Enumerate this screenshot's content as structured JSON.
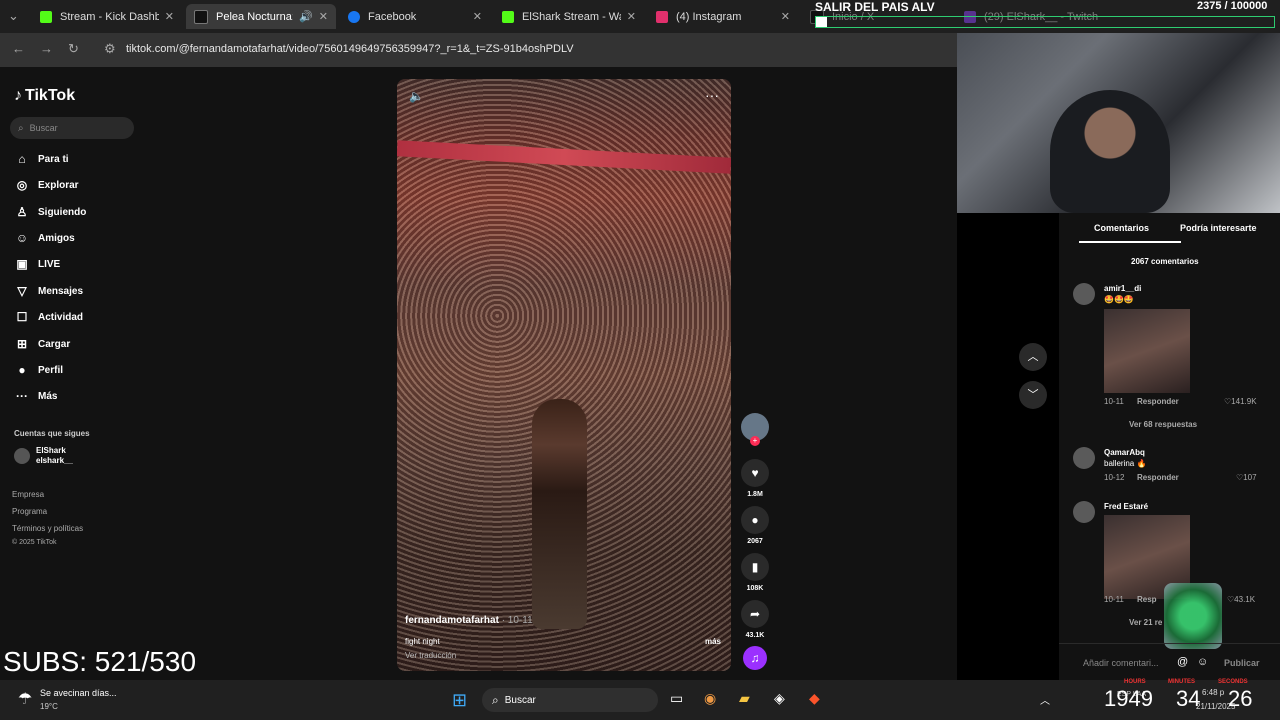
{
  "tabs": [
    {
      "label": "Stream - Kick Dashboa",
      "color": "#53fc18"
    },
    {
      "label": "Pelea Nocturna: Fe",
      "color": "#111111"
    },
    {
      "label": "Facebook",
      "color": "#1877f2"
    },
    {
      "label": "ElShark Stream - Watc",
      "color": "#53fc18"
    },
    {
      "label": "(4) Instagram",
      "color": "#e1306c"
    },
    {
      "label": "Inicio / X",
      "color": "#000000"
    },
    {
      "label": "(29) ElShark__ - Twitch",
      "color": "#9146ff"
    }
  ],
  "url": "tiktok.com/@fernandamotafarhat/video/7560149649756359947?_r=1&_t=ZS-91b4oshPDLV",
  "overlay": {
    "salir": "SALIR DEL PAIS ALV",
    "goal": "2375 / 100000",
    "subs": "SUBS: 521/530",
    "timer_labels": [
      "HOURS",
      "MINUTES",
      "SECONDS"
    ],
    "timer_values": [
      "1949",
      "34",
      "26"
    ]
  },
  "tiktok": {
    "logo": "TikTok",
    "search_placeholder": "Buscar",
    "nav": [
      "Para ti",
      "Explorar",
      "Siguiendo",
      "Amigos",
      "LIVE",
      "Mensajes",
      "Actividad",
      "Cargar",
      "Perfil",
      "Más"
    ],
    "following_title": "Cuentas que sigues",
    "following": {
      "name": "ElShark",
      "handle": "elshark__"
    },
    "footer": [
      "Empresa",
      "Programa",
      "Términos y políticas",
      "© 2025 TikTok"
    ],
    "video": {
      "author": "fernandamotafarhat",
      "date": "· 10-11",
      "caption": "fight night",
      "translate": "Ver traducción",
      "more": "más"
    },
    "actions": {
      "likes": "1.8M",
      "comments": "2067",
      "saves": "108K",
      "shares": "43.1K"
    }
  },
  "comments": {
    "tabs": [
      "Comentarios",
      "Podría interesarte"
    ],
    "count": "2067 comentarios",
    "items": [
      {
        "user": "amir1__di",
        "text": "🤩🤩🤩",
        "date": "10-11",
        "reply": "Responder",
        "likes": "141.9K",
        "replies": "Ver 68 respuestas"
      },
      {
        "user": "QamarAbq",
        "text": "ballerina 🔥",
        "date": "10-12",
        "reply": "Responder",
        "likes": "107"
      },
      {
        "user": "Fred Estaré",
        "text": "",
        "date": "10-11",
        "reply": "Resp",
        "likes": "43.1K",
        "replies": "Ver 21 re"
      }
    ],
    "input_placeholder": "Añadir comentari...",
    "post": "Publicar"
  },
  "taskbar": {
    "weather_text": "Se avecinan días...",
    "weather_temp": "19°C",
    "search": "Buscar",
    "time": "6:48 p",
    "date": "21/11/2025",
    "lang": "ESP LAA"
  }
}
